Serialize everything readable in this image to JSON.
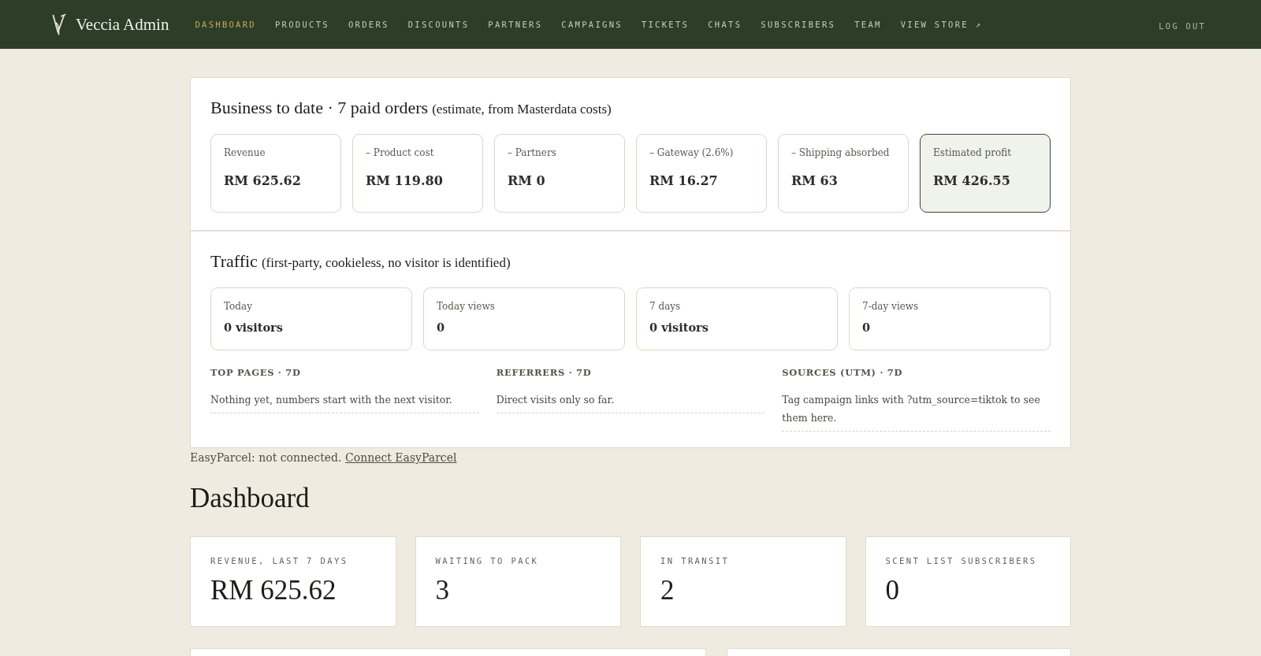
{
  "nav": {
    "brand": "Veccia Admin",
    "items": [
      {
        "label": "DASHBOARD",
        "selected": true
      },
      {
        "label": "PRODUCTS",
        "selected": false
      },
      {
        "label": "ORDERS",
        "selected": false
      },
      {
        "label": "DISCOUNTS",
        "selected": false
      },
      {
        "label": "PARTNERS",
        "selected": false
      },
      {
        "label": "CAMPAIGNS",
        "selected": false
      },
      {
        "label": "TICKETS",
        "selected": false
      },
      {
        "label": "CHATS",
        "selected": false
      },
      {
        "label": "SUBSCRIBERS",
        "selected": false
      },
      {
        "label": "TEAM",
        "selected": false
      },
      {
        "label": "VIEW STORE ↗",
        "selected": false
      }
    ],
    "logout": "LOG OUT"
  },
  "business": {
    "title": "Business to date · 7 paid orders",
    "note": "(estimate, from Masterdata costs)",
    "cards": [
      {
        "label": "Revenue",
        "value": "RM 625.62",
        "highlighted": false
      },
      {
        "label": "– Product cost",
        "value": "RM 119.80",
        "highlighted": false
      },
      {
        "label": "– Partners",
        "value": "RM 0",
        "highlighted": false
      },
      {
        "label": "– Gateway (2.6%)",
        "value": "RM 16.27",
        "highlighted": false
      },
      {
        "label": "– Shipping absorbed",
        "value": "RM 63",
        "highlighted": false
      },
      {
        "label": "Estimated profit",
        "value": "RM 426.55",
        "highlighted": true
      }
    ]
  },
  "traffic": {
    "title": "Traffic",
    "note": "(first-party, cookieless, no visitor is identified)",
    "cards": [
      {
        "label": "Today",
        "value": "0 visitors"
      },
      {
        "label": "Today views",
        "value": "0"
      },
      {
        "label": "7 days",
        "value": "0 visitors"
      },
      {
        "label": "7-day views",
        "value": "0"
      }
    ],
    "lists": [
      {
        "heading": "TOP PAGES · 7D",
        "text": "Nothing yet, numbers start with the next visitor."
      },
      {
        "heading": "REFERRERS · 7D",
        "text": "Direct visits only so far."
      },
      {
        "heading": "SOURCES (UTM) · 7D",
        "text": "Tag campaign links with ?utm_source=tiktok to see them here."
      }
    ]
  },
  "easyparcel": {
    "status": "EasyParcel: not connected.",
    "link": "Connect EasyParcel"
  },
  "dashboard": {
    "title": "Dashboard",
    "stats": [
      {
        "label": "REVENUE, LAST 7 DAYS",
        "value": "RM 625.62"
      },
      {
        "label": "WAITING TO PACK",
        "value": "3"
      },
      {
        "label": "IN TRANSIT",
        "value": "2"
      },
      {
        "label": "SCENT LIST SUBSCRIBERS",
        "value": "0"
      }
    ]
  }
}
